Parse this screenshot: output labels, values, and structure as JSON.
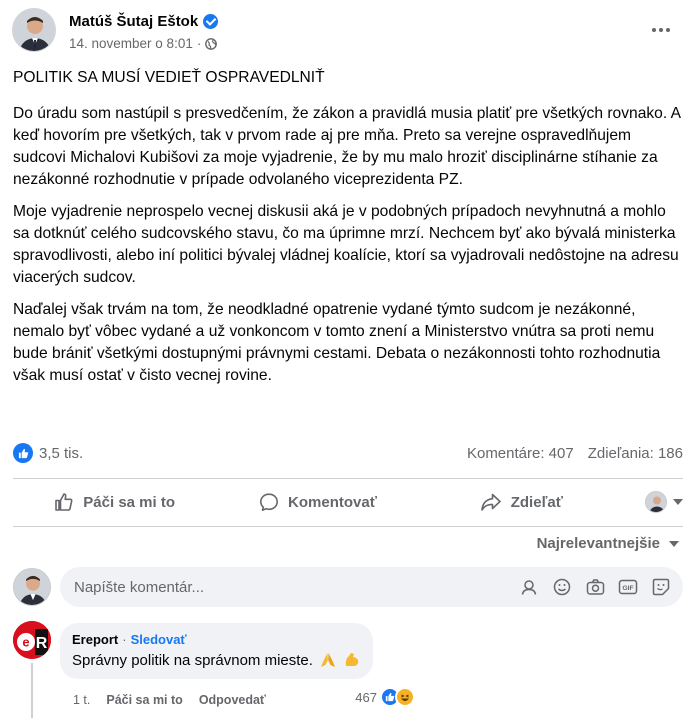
{
  "post": {
    "author": "Matúš Šutaj Eštok",
    "timestamp": "14. november o 8:01",
    "separator": "·",
    "title": "POLITIK SA MUSÍ VEDIEŤ OSPRAVEDLNIŤ",
    "paragraphs": [
      "Do úradu som nastúpil s presvedčením, že zákon a pravidlá musia platiť pre všetkých rovnako. A keď hovorím pre všetkých, tak v prvom rade aj pre mňa. Preto sa verejne ospravedlňujem sudcovi Michalovi Kubišovi za moje vyjadrenie, že by mu malo hroziť disciplinárne stíhanie za nezákonné rozhodnutie v prípade odvolaného viceprezidenta PZ.",
      "Moje vyjadrenie neprospelo vecnej diskusii aká je v podobných prípadoch nevyhnutná a mohlo sa dotknúť celého sudcovského stavu, čo ma úprimne mrzí. Nechcem byť ako bývalá ministerka spravodlivosti, alebo iní politici bývalej vládnej koalície, ktorí sa vyjadrovali nedôstojne na adresu viacerých sudcov.",
      "Naďalej však trvám na tom, že neodkladné opatrenie vydané týmto sudcom je nezákonné, nemalo byť vôbec vydané a už vonkoncom v tomto znení a Ministerstvo vnútra sa proti nemu bude brániť všetkými dostupnými právnymi cestami. Debata o nezákonnosti tohto rozhodnutia však musí ostať v čisto vecnej rovine."
    ]
  },
  "stats": {
    "reactions": "3,5 tis.",
    "comments": "Komentáre: 407",
    "shares": "Zdieľania: 186"
  },
  "actions": {
    "like": "Páči sa mi to",
    "comment": "Komentovať",
    "share": "Zdieľať"
  },
  "sort_label": "Najrelevantnejšie",
  "composer": {
    "placeholder": "Napíšte komentár..."
  },
  "comment": {
    "author": "Ereport",
    "separator": "·",
    "follow": "Sledovať",
    "text": "Správny politik na správnom mieste.",
    "time": "1 t.",
    "like": "Páči sa mi to",
    "reply": "Odpovedať",
    "reaction_count": "467"
  },
  "colors": {
    "accent": "#1877f2",
    "muted_text": "#65676b",
    "bubble_bg": "#f0f2f5",
    "divider": "#ced0d4"
  }
}
